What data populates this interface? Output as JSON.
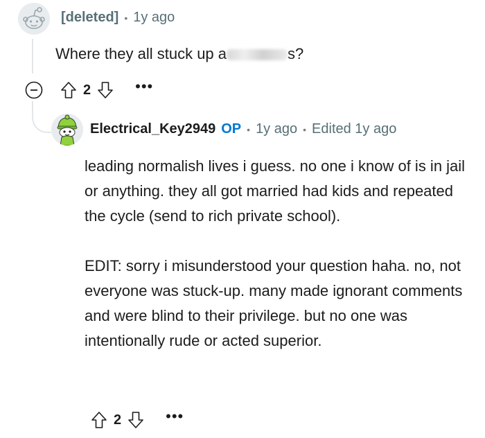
{
  "comments": [
    {
      "username": "[deleted]",
      "time": "1y ago",
      "body_before": "Where they all stuck up a",
      "body_after": "s?",
      "votes": "2",
      "more": "•••"
    },
    {
      "username": "Electrical_Key2949",
      "op_badge": "OP",
      "time": "1y ago",
      "edited": "Edited 1y ago",
      "paragraphs": [
        "leading normalish lives i guess. no one i know of is in jail or anything. they all got married had kids and repeated the cycle (send to rich private school).",
        "EDIT: sorry i misunderstood your question haha. no, not everyone was stuck-up. many made ignorant comments and were blind to their privilege. but no one was intentionally rude or acted superior."
      ],
      "votes": "2",
      "more": "•••"
    }
  ],
  "separator": "•",
  "icons": {
    "deleted_avatar": "snoo-outline-avatar",
    "op_avatar": "green-beanie-snoo-avatar",
    "collapse": "collapse-minus-icon",
    "upvote": "arrow-up-outline-icon",
    "downvote": "arrow-down-outline-icon",
    "more": "ellipsis-icon"
  },
  "colors": {
    "op_badge": "#0079d3",
    "muted": "#576f76",
    "thread_line": "#e4e6e8",
    "avatar_green": "#8fd23d"
  }
}
